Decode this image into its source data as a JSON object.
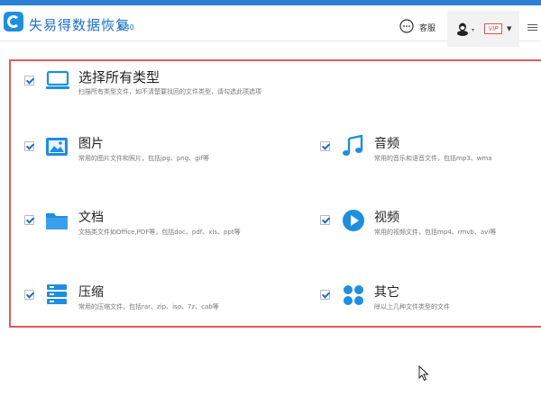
{
  "app": {
    "title": "失易得数据恢复",
    "version": "6.40"
  },
  "header": {
    "support_label": "客服",
    "vip_label": "VIP"
  },
  "options": {
    "all": {
      "label": "选择所有类型",
      "desc": "扫描所有类型文件，如不清楚要找回的文件类型，请勾选此项选项",
      "checked": true
    },
    "image": {
      "label": "图片",
      "desc": "常用的图片文件和照片，包括jpg、png、gif等",
      "checked": true
    },
    "audio": {
      "label": "音频",
      "desc": "常用的音乐和语音文件，包括mp3、wma",
      "checked": true
    },
    "doc": {
      "label": "文档",
      "desc": "文档类文件如Office,PDF等，包括doc、pdf、xls、ppt等",
      "checked": true
    },
    "video": {
      "label": "视频",
      "desc": "常用的视频文件，包括mp4、rmvb、avi等",
      "checked": true
    },
    "zip": {
      "label": "压缩",
      "desc": "常用的压缩文件，包括rar、zip、iso、7z、cab等",
      "checked": true
    },
    "other": {
      "label": "其它",
      "desc": "除以上几种文件类型的文件",
      "checked": true
    }
  },
  "colors": {
    "accent": "#1e8ee0",
    "panel_border": "#e05a5a",
    "vip": "#d9534f"
  }
}
